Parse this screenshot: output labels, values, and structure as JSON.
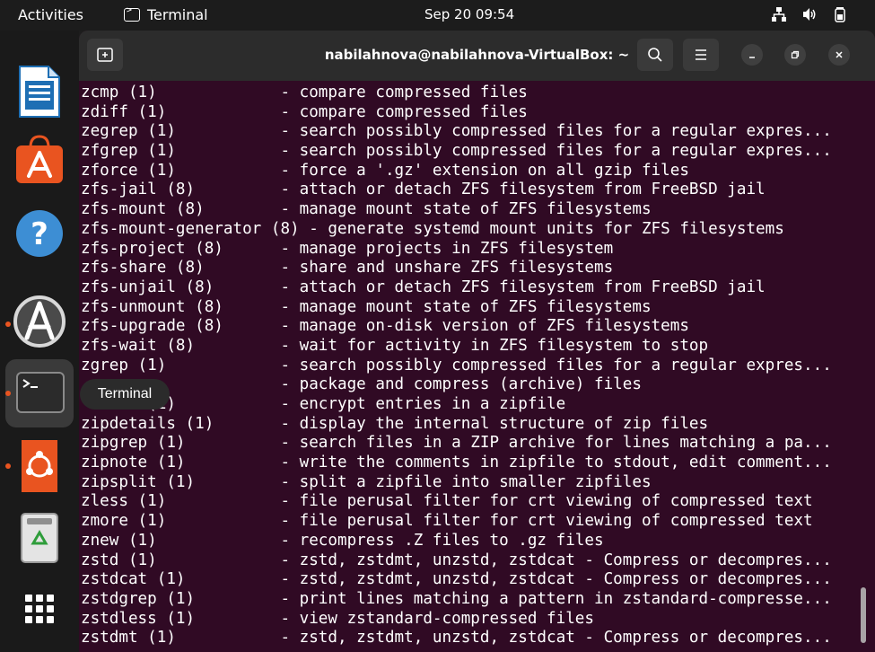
{
  "topbar": {
    "activities": "Activities",
    "app_name": "Terminal",
    "clock": "Sep 20  09:54",
    "icons": [
      "network-icon",
      "volume-icon",
      "battery-icon"
    ]
  },
  "dock": {
    "items": [
      {
        "name": "LibreOffice Writer",
        "icon": "writer-icon"
      },
      {
        "name": "Ubuntu Software",
        "icon": "software-store-icon"
      },
      {
        "name": "Help",
        "icon": "help-icon"
      },
      {
        "name": "Software Updater",
        "icon": "updater-icon"
      },
      {
        "name": "Terminal",
        "icon": "terminal-icon"
      },
      {
        "name": "Ubuntu Installer",
        "icon": "ubuntu-installer-icon"
      },
      {
        "name": "Trash",
        "icon": "trash-icon"
      },
      {
        "name": "Show Applications",
        "icon": "app-grid-icon"
      }
    ],
    "tooltip": "Terminal"
  },
  "window": {
    "title": "nabilahnova@nabilahnova-VirtualBox: ~",
    "buttons": [
      "new-tab",
      "search",
      "menu",
      "minimize",
      "maximize",
      "close"
    ]
  },
  "terminal": {
    "lines": [
      "zcmp (1)             - compare compressed files",
      "zdiff (1)            - compare compressed files",
      "zegrep (1)           - search possibly compressed files for a regular expres...",
      "zfgrep (1)           - search possibly compressed files for a regular expres...",
      "zforce (1)           - force a '.gz' extension on all gzip files",
      "zfs-jail (8)         - attach or detach ZFS filesystem from FreeBSD jail",
      "zfs-mount (8)        - manage mount state of ZFS filesystems",
      "zfs-mount-generator (8) - generate systemd mount units for ZFS filesystems",
      "zfs-project (8)      - manage projects in ZFS filesystem",
      "zfs-share (8)        - share and unshare ZFS filesystems",
      "zfs-unjail (8)       - attach or detach ZFS filesystem from FreeBSD jail",
      "zfs-unmount (8)      - manage mount state of ZFS filesystems",
      "zfs-upgrade (8)      - manage on-disk version of ZFS filesystems",
      "zfs-wait (8)         - wait for activity in ZFS filesystem to stop",
      "zgrep (1)            - search possibly compressed files for a regular expres...",
      "                     - package and compress (archive) files",
      "       (1)           - encrypt entries in a zipfile",
      "zipdetails (1)       - display the internal structure of zip files",
      "zipgrep (1)          - search files in a ZIP archive for lines matching a pa...",
      "zipnote (1)          - write the comments in zipfile to stdout, edit comment...",
      "zipsplit (1)         - split a zipfile into smaller zipfiles",
      "zless (1)            - file perusal filter for crt viewing of compressed text",
      "zmore (1)            - file perusal filter for crt viewing of compressed text",
      "znew (1)             - recompress .Z files to .gz files",
      "zstd (1)             - zstd, zstdmt, unzstd, zstdcat - Compress or decompres...",
      "zstdcat (1)          - zstd, zstdmt, unzstd, zstdcat - Compress or decompres...",
      "zstdgrep (1)         - print lines matching a pattern in zstandard-compresse...",
      "zstdless (1)         - view zstandard-compressed files",
      "zstdmt (1)           - zstd, zstdmt, unzstd, zstdcat - Compress or decompres..."
    ]
  },
  "colors": {
    "terminal_bg": "#300a24",
    "ubuntu_orange": "#e95420",
    "headerbar": "#2c2c2c"
  }
}
